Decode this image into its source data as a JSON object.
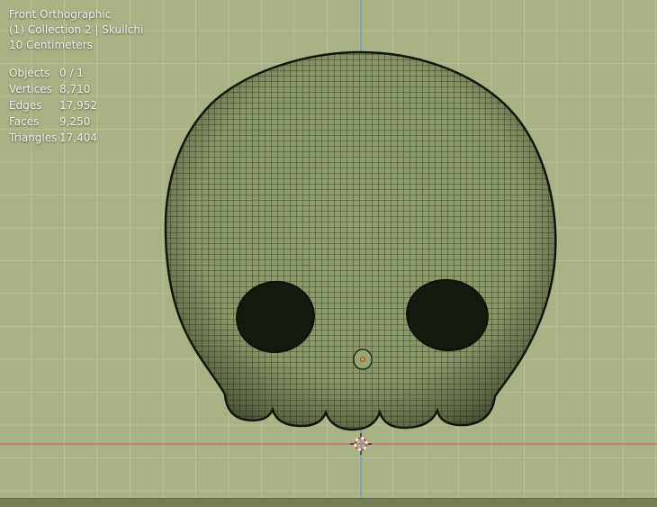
{
  "viewport": {
    "header": {
      "view_label": "Front Orthographic",
      "collection_label": "(1) Collection 2 | Skullchi",
      "scale_label": "10 Centimeters"
    },
    "stats": {
      "rows": [
        {
          "label": "Objects",
          "value": "0 / 1"
        },
        {
          "label": "Vertices",
          "value": "8,710"
        },
        {
          "label": "Edges",
          "value": "17,952"
        },
        {
          "label": "Faces",
          "value": "9,250"
        },
        {
          "label": "Triangles",
          "value": "17,404"
        }
      ]
    },
    "object_name": "Skullchi",
    "colors": {
      "background": "#a8b284",
      "grid_line": "#c8d0b0",
      "axis_x": "#cd7b74",
      "axis_z": "#7d99c4",
      "wireframe": "#242d19",
      "mesh_fill": "#91a06e",
      "outline": "#10150b",
      "eye_fill": "#141a0e",
      "origin_dot": "#e8903a",
      "cursor_red": "#c94444",
      "cursor_white": "#ffffff",
      "text": "#f1f1f1"
    }
  }
}
